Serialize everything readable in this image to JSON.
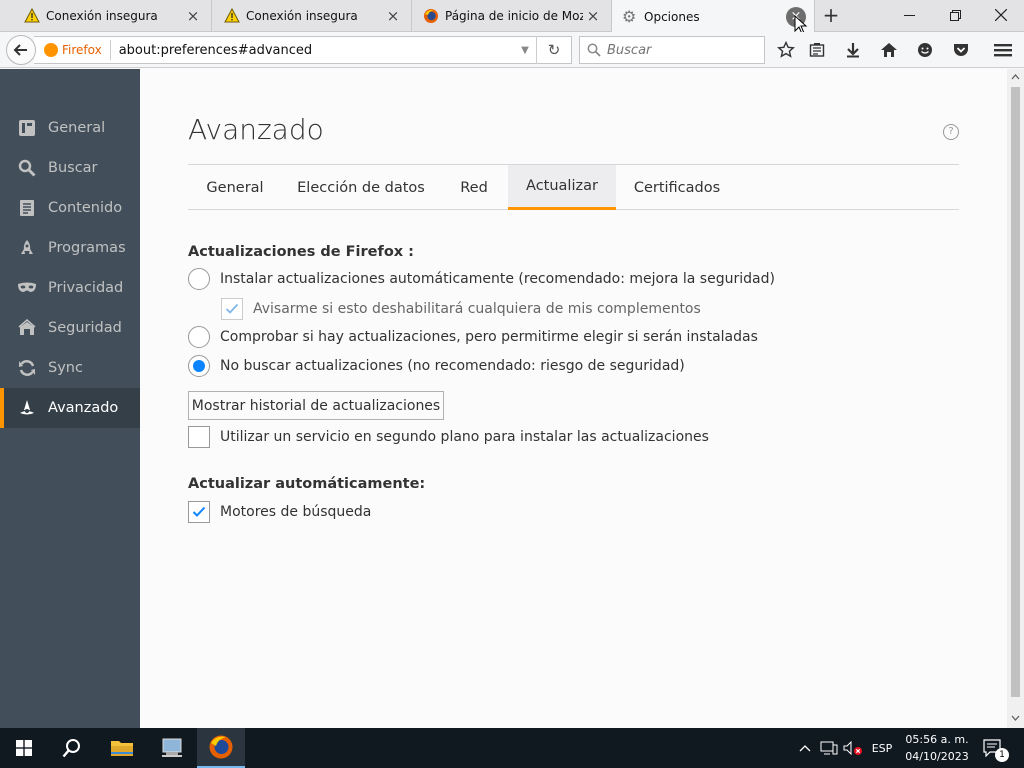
{
  "tabs": [
    {
      "title": "Conexión insegura",
      "icon": "warning-icon",
      "close": "×"
    },
    {
      "title": "Conexión insegura",
      "icon": "warning-icon",
      "close": "×"
    },
    {
      "title": "Página de inicio de Moz...",
      "icon": "firefox-icon",
      "close": "×"
    },
    {
      "title": "Opciones",
      "icon": "gear-icon",
      "close": "×",
      "selected": true
    }
  ],
  "new_tab": "+",
  "window_controls": {
    "minimize": "—",
    "restore": "❐",
    "close": "✕"
  },
  "navbar": {
    "identity_label": "Firefox",
    "url": "about:preferences#advanced",
    "search_placeholder": "Buscar",
    "dropdown": "▼",
    "reload": "↻"
  },
  "sidebar": {
    "items": [
      {
        "label": "General",
        "icon": "general-icon"
      },
      {
        "label": "Buscar",
        "icon": "search-icon"
      },
      {
        "label": "Contenido",
        "icon": "content-icon"
      },
      {
        "label": "Programas",
        "icon": "applications-icon"
      },
      {
        "label": "Privacidad",
        "icon": "privacy-mask-icon"
      },
      {
        "label": "Seguridad",
        "icon": "security-icon"
      },
      {
        "label": "Sync",
        "icon": "sync-icon"
      },
      {
        "label": "Avanzado",
        "icon": "advanced-icon",
        "selected": true
      }
    ]
  },
  "page": {
    "title": "Avanzado",
    "help": "?",
    "tabs": [
      "General",
      "Elección de datos",
      "Red",
      "Actualizar",
      "Certificados"
    ],
    "selected_tab": "Actualizar",
    "updates_heading": "Actualizaciones de Firefox :",
    "radio_auto": "Instalar actualizaciones automáticamente (recomendado: mejora la seguridad)",
    "check_addons": "Avisarme si esto deshabilitará cualquiera de mis complementos",
    "radio_check": "Comprobar si hay actualizaciones, pero permitirme elegir si serán instaladas",
    "radio_never": "No buscar actualizaciones (no recomendado: riesgo de seguridad)",
    "history_button": "Mostrar historial de actualizaciones",
    "check_service": "Utilizar un servicio en segundo plano para instalar las actualizaciones",
    "auto_update_heading": "Actualizar automáticamente:",
    "check_engines": "Motores de búsqueda",
    "state": {
      "radio_selected": "never",
      "check_addons": true,
      "check_addons_disabled": true,
      "check_service": false,
      "check_engines": true
    }
  },
  "taskbar": {
    "language": "ESP",
    "time": "05:56 a. m.",
    "date": "04/10/2023",
    "notification_count": "1"
  },
  "colors": {
    "accent": "#ff9500",
    "radio_selected": "#0a84ff",
    "sidebar_bg": "#424f5a",
    "taskbar_bg": "#101820"
  }
}
